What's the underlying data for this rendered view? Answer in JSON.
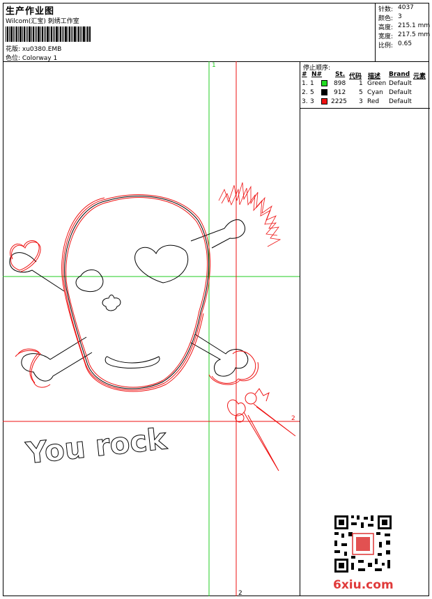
{
  "header": {
    "title": "生产作业图",
    "company": "Wilcom(汇宝) 刺绣工作室",
    "design_file": "花版: xu0380.EMB",
    "colorway": "色位: Colorway 1"
  },
  "stats": [
    {
      "label": "针数:",
      "value": "4037"
    },
    {
      "label": "颜色:",
      "value": "3"
    },
    {
      "label": "高度:",
      "value": "215.1 mm"
    },
    {
      "label": "宽度:",
      "value": "217.5 mm"
    },
    {
      "label": "比例:",
      "value": "0.65"
    }
  ],
  "stop_sequence": {
    "title": "停止顺序:",
    "columns": [
      "#",
      "N#",
      "St.",
      "代码",
      "描述",
      "Brand",
      "元素"
    ],
    "rows": [
      {
        "num": "1.",
        "n": "1",
        "color": "#22dd22",
        "stitches": "898",
        "code": "1",
        "desc": "Green",
        "brand": "Default"
      },
      {
        "num": "2.",
        "n": "5",
        "color": "#000000",
        "stitches": "912",
        "code": "5",
        "desc": "Cyan",
        "brand": "Default"
      },
      {
        "num": "3.",
        "n": "3",
        "color": "#ee1111",
        "stitches": "2225",
        "code": "3",
        "desc": "Red",
        "brand": "Default"
      }
    ]
  },
  "canvas": {
    "marker_top": "1",
    "marker_right": "2",
    "marker_bottom": "2",
    "embroidery_text": "You rock",
    "guide_colors": {
      "green": "#22cc22",
      "red": "#ee1111"
    }
  },
  "watermark": {
    "site": "6xiu.com"
  }
}
